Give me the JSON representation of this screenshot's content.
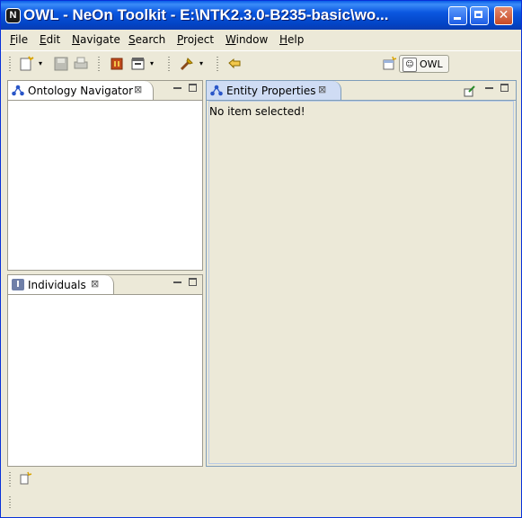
{
  "window": {
    "title": "OWL - NeOn Toolkit - E:\\NTK2.3.0-B235-basic\\wo...",
    "app_icon_glyph": "N",
    "close_glyph": "✕"
  },
  "menu": {
    "items": [
      {
        "mnemonic": "F",
        "rest": "ile"
      },
      {
        "mnemonic": "E",
        "rest": "dit"
      },
      {
        "mnemonic": "N",
        "rest": "avigate"
      },
      {
        "mnemonic": "S",
        "rest": "earch"
      },
      {
        "mnemonic": "P",
        "rest": "roject"
      },
      {
        "mnemonic": "W",
        "rest": "indow"
      },
      {
        "mnemonic": "H",
        "rest": "elp"
      }
    ]
  },
  "toolbar": {
    "icons": [
      "new-wizard-icon",
      "save-icon",
      "print-icon",
      "stop-icon",
      "run-icon",
      "tool-icon",
      "back-icon"
    ],
    "dropdown_glyph": "▾"
  },
  "perspective": {
    "label": "OWL",
    "icon_glyph": "☺"
  },
  "views": {
    "ontology_navigator": {
      "label": "Ontology Navigator",
      "close_glyph": "⊠"
    },
    "individuals": {
      "label": "Individuals",
      "icon_glyph": "I",
      "close_glyph": "⊠"
    },
    "entity_properties": {
      "label": "Entity Properties",
      "close_glyph": "⊠",
      "content": "No item selected!"
    }
  },
  "colors": {
    "title_blue": "#0244C6",
    "window_bg": "#ECE9D8",
    "active_tab": "#CFDCF4"
  }
}
